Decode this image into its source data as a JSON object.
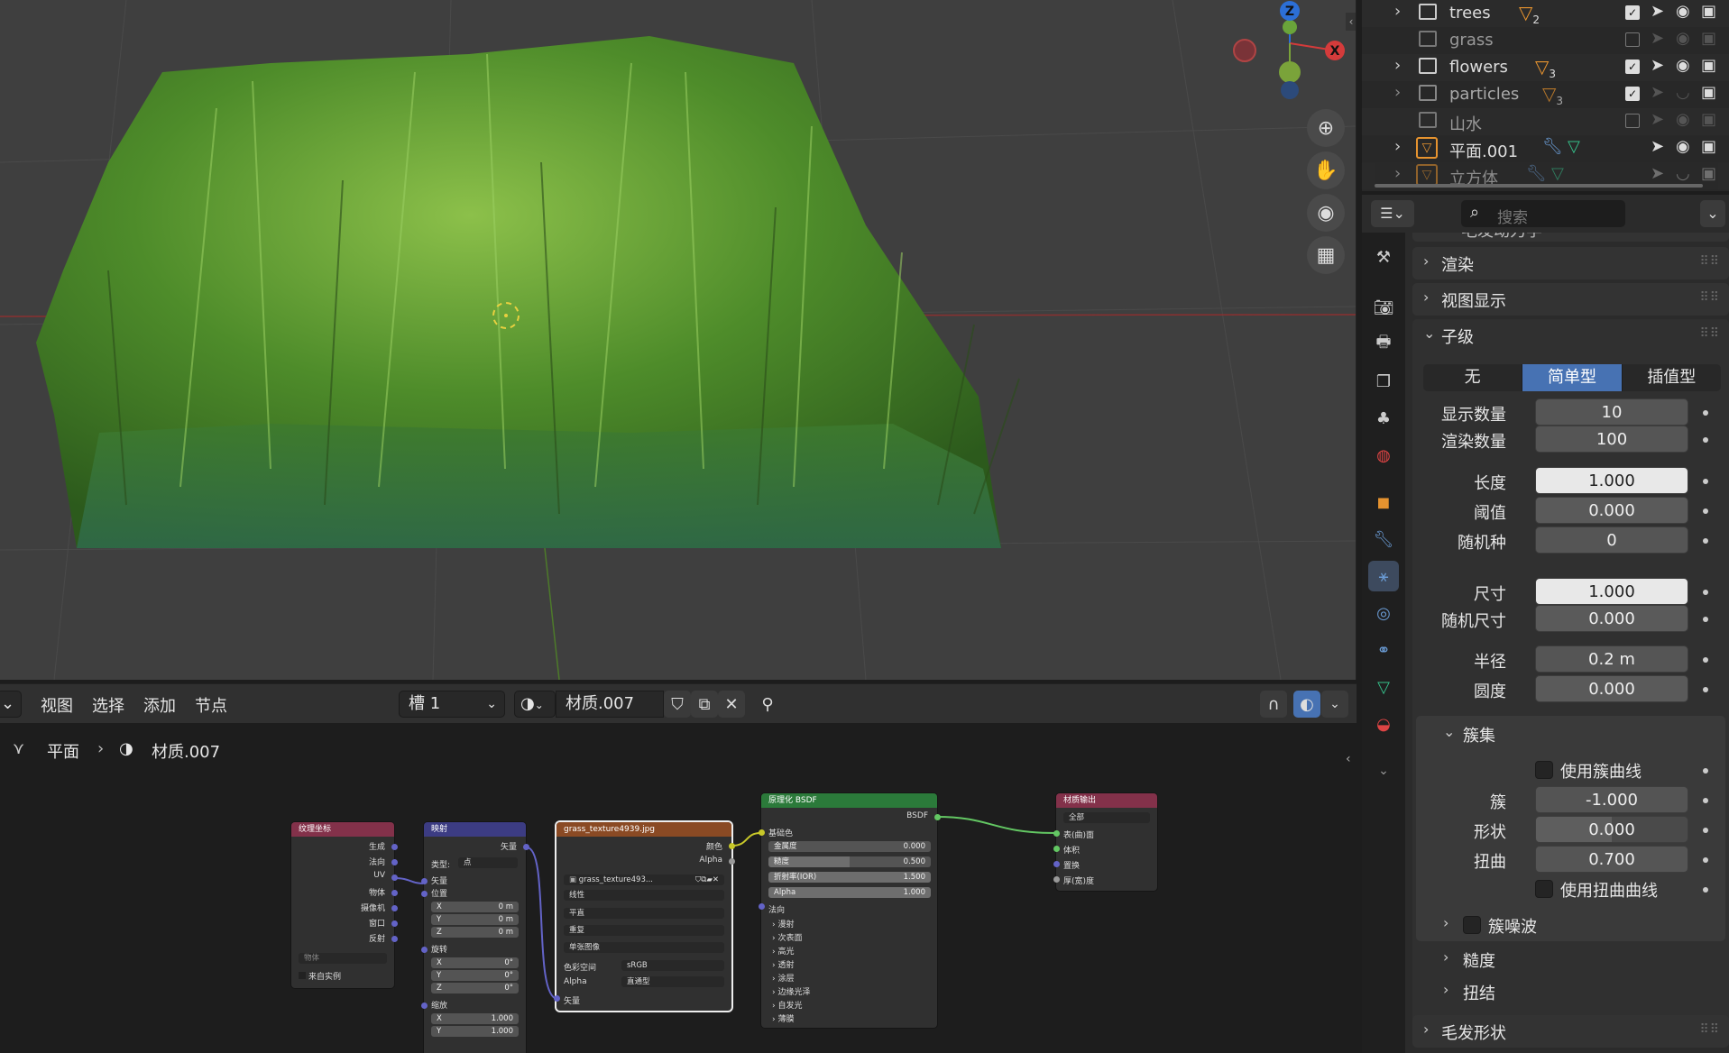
{
  "viewport": {
    "gizmo": {
      "z": "Z",
      "x": "X"
    }
  },
  "node_editor": {
    "menu": [
      "视图",
      "选择",
      "添加",
      "节点"
    ],
    "slot": "槽 1",
    "material": "材质.007",
    "breadcrumb": {
      "object": "平面",
      "material": "材质.007"
    },
    "nodes": {
      "texcoord": {
        "title": "纹理坐标",
        "outputs": [
          "生成",
          "法向",
          "UV",
          "物体",
          "摄像机",
          "窗口",
          "反射"
        ],
        "object_placeholder": "物体",
        "from_instancer": "来自实例"
      },
      "mapping": {
        "title": "映射",
        "output": "矢量",
        "type_label": "类型:",
        "type_value": "点",
        "vector": "矢量",
        "location": "位置",
        "loc": [
          {
            "k": "X",
            "v": "0 m"
          },
          {
            "k": "Y",
            "v": "0 m"
          },
          {
            "k": "Z",
            "v": "0 m"
          }
        ],
        "rotation": "旋转",
        "rot": [
          {
            "k": "X",
            "v": "0°"
          },
          {
            "k": "Y",
            "v": "0°"
          },
          {
            "k": "Z",
            "v": "0°"
          }
        ],
        "scale": "缩放",
        "scl": [
          {
            "k": "X",
            "v": "1.000"
          },
          {
            "k": "Y",
            "v": "1.000"
          }
        ]
      },
      "image": {
        "title": "grass_texture4939.jpg",
        "out_color": "颜色",
        "out_alpha": "Alpha",
        "file": "grass_texture493...",
        "interpolation": "线性",
        "projection": "平直",
        "extension": "重复",
        "source": "单张图像",
        "colorspace_label": "色彩空间",
        "colorspace": "sRGB",
        "alpha_label": "Alpha",
        "alpha": "直通型",
        "in_vector": "矢量"
      },
      "bsdf": {
        "title": "原理化 BSDF",
        "out": "BSDF",
        "base_color": "基础色",
        "fields": [
          {
            "k": "金属度",
            "v": "0.000",
            "fill": 0.0
          },
          {
            "k": "糙度",
            "v": "0.500",
            "fill": 0.5
          },
          {
            "k": "折射率(IOR)",
            "v": "1.500",
            "fill": 1.0
          },
          {
            "k": "Alpha",
            "v": "1.000",
            "fill": 1.0
          }
        ],
        "normal": "法向",
        "subpanels": [
          "漫射",
          "次表面",
          "高光",
          "透射",
          "涂层",
          "边缘光泽",
          "自发光",
          "薄膜"
        ]
      },
      "output": {
        "title": "材质输出",
        "target": "全部",
        "inputs": [
          "表(曲)面",
          "体积",
          "置换",
          "厚(宽)度"
        ]
      }
    }
  },
  "outliner": {
    "rows": [
      {
        "name": "trees",
        "count": "2",
        "visible": true
      },
      {
        "name": "grass",
        "count": "",
        "visible": false
      },
      {
        "name": "flowers",
        "count": "3",
        "visible": true
      },
      {
        "name": "particles",
        "count": "3",
        "visible": true
      },
      {
        "name": "山水",
        "count": "",
        "visible": false
      },
      {
        "name": "平面.001",
        "count": "",
        "visible": true
      },
      {
        "name": "立方体",
        "count": "",
        "visible": false
      }
    ]
  },
  "properties": {
    "search_placeholder": "搜索",
    "top_cut": "毛发动力学",
    "sections": {
      "render": "渲染",
      "viewport_display": "视图显示",
      "children": "子级",
      "hair_shape": "毛发形状"
    },
    "child_modes": [
      "无",
      "简单型",
      "插值型"
    ],
    "active_mode": "简单型",
    "fields": [
      {
        "label": "显示数量",
        "value": "10"
      },
      {
        "label": "渲染数量",
        "value": "100"
      },
      {
        "label": "长度",
        "value": "1.000"
      },
      {
        "label": "阈值",
        "value": "0.000"
      },
      {
        "label": "随机种",
        "value": "0"
      },
      {
        "label": "尺寸",
        "value": "1.000"
      },
      {
        "label": "随机尺寸",
        "value": "0.000"
      },
      {
        "label": "半径",
        "value": "0.2 m"
      },
      {
        "label": "圆度",
        "value": "0.000"
      }
    ],
    "clump": {
      "title": "簇集",
      "use_curve": "使用簇曲线",
      "fields": [
        {
          "label": "簇",
          "value": "-1.000"
        },
        {
          "label": "形状",
          "value": "0.000"
        },
        {
          "label": "扭曲",
          "value": "0.700"
        }
      ],
      "use_twist_curve": "使用扭曲曲线",
      "noise": "簇噪波"
    },
    "roughness": "糙度",
    "kink": "扭结"
  }
}
